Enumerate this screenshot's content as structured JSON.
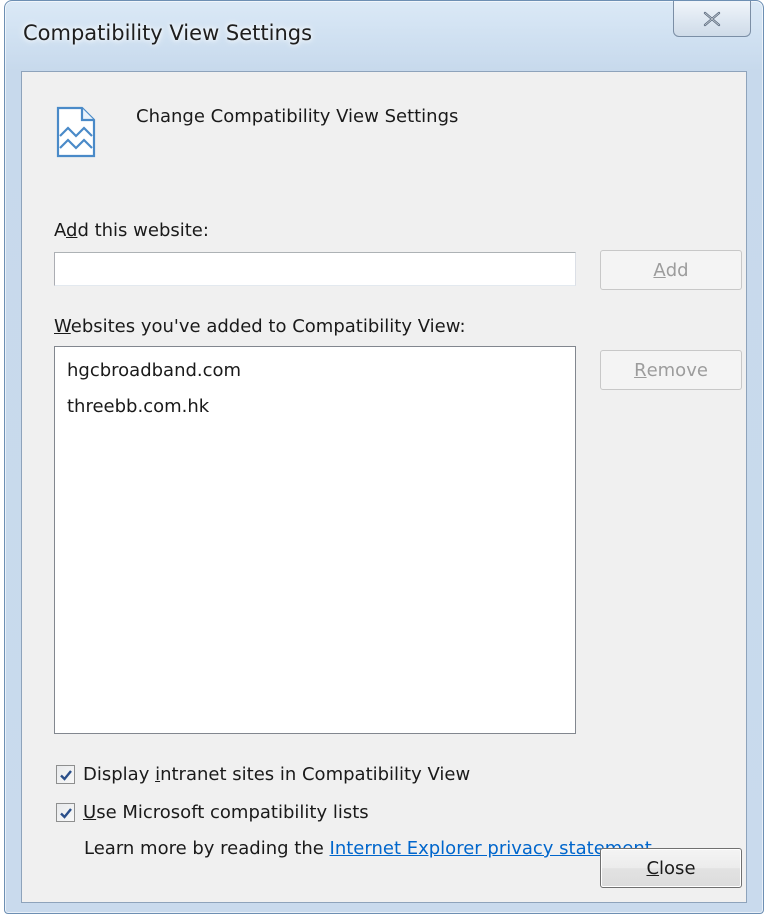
{
  "window": {
    "title": "Compatibility View Settings",
    "close_glyph": "✕"
  },
  "header": {
    "icon": "compatibility-view-icon",
    "text": "Change Compatibility View Settings"
  },
  "add_section": {
    "label_prefix": "A",
    "label_mnemonic": "d",
    "label_suffix": "d this website:",
    "input_value": "",
    "input_placeholder": "",
    "add_button_prefix": "",
    "add_button_mnemonic": "A",
    "add_button_suffix": "dd"
  },
  "list_section": {
    "label_mnemonic": "W",
    "label_suffix": "ebsites you've added to Compatibility View:",
    "items": [
      "hgcbroadband.com",
      "threebb.com.hk"
    ],
    "remove_button_mnemonic": "R",
    "remove_button_suffix": "emove"
  },
  "options": {
    "intranet_prefix": "Display ",
    "intranet_mnemonic": "i",
    "intranet_suffix": "ntranet sites in Compatibility View",
    "intranet_checked": true,
    "mslists_mnemonic": "U",
    "mslists_suffix": "se Microsoft compatibility lists",
    "mslists_checked": true
  },
  "info": {
    "text": "Learn more by reading the ",
    "link": "Internet Explorer privacy statement"
  },
  "footer": {
    "close_mnemonic": "C",
    "close_suffix": "lose"
  },
  "colors": {
    "link": "#0066cc",
    "frame": "#c7d9ec",
    "client": "#f0f0f0"
  }
}
